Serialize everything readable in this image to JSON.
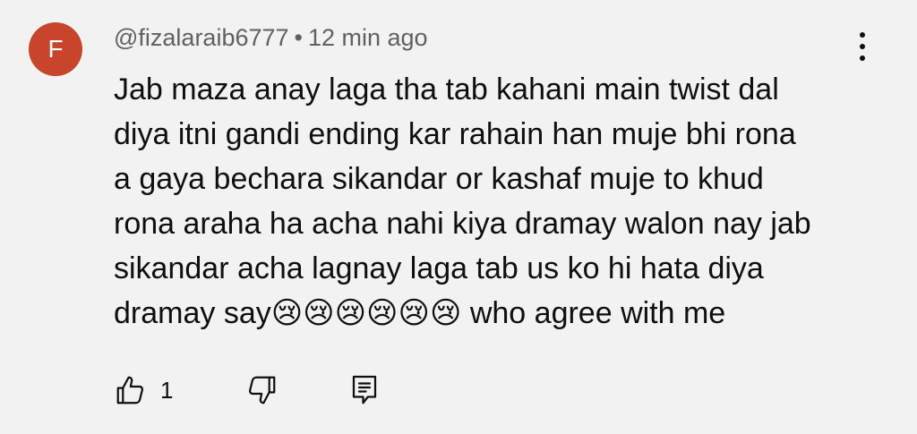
{
  "comment": {
    "avatar_letter": "F",
    "avatar_color": "#c8442a",
    "author": "@fizalaraib6777",
    "separator": "•",
    "timestamp": "12 min ago",
    "text": "Jab maza anay laga tha tab kahani main twist dal\ndiya itni gandi ending kar rahain han muje bhi rona\na gaya bechara sikandar or kashaf muje to khud\nrona araha ha acha nahi kiya dramay walon nay jab\nsikandar acha lagnay laga tab us ko hi hata diya\ndramay say😢😢😢😢😢😢 who agree with me",
    "like_count": "1",
    "icons": {
      "menu": "more-vert-icon",
      "like": "thumbs-up-icon",
      "dislike": "thumbs-down-icon",
      "reply": "reply-icon"
    }
  }
}
